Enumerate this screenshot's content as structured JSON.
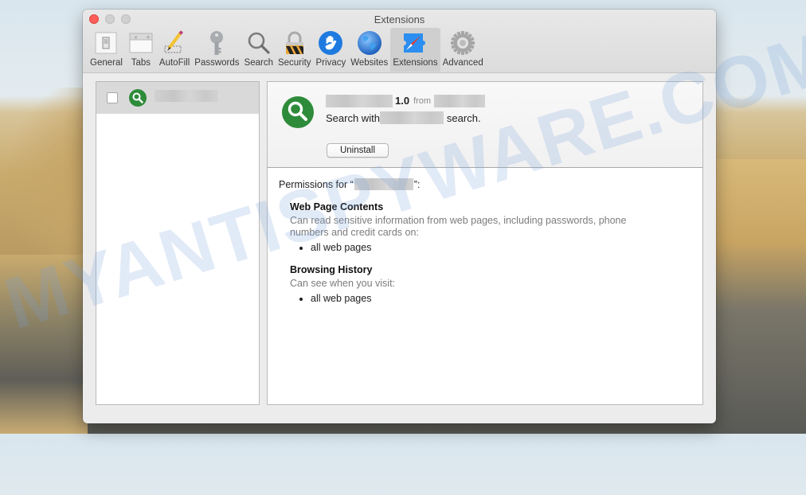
{
  "window": {
    "title": "Extensions"
  },
  "toolbar": {
    "items": [
      {
        "label": "General",
        "icon": "general-switch-icon",
        "active": false
      },
      {
        "label": "Tabs",
        "icon": "tabs-icon",
        "active": false
      },
      {
        "label": "AutoFill",
        "icon": "pencil-icon",
        "active": false
      },
      {
        "label": "Passwords",
        "icon": "key-icon",
        "active": false
      },
      {
        "label": "Search",
        "icon": "magnifier-icon",
        "active": false
      },
      {
        "label": "Security",
        "icon": "padlock-icon",
        "active": false
      },
      {
        "label": "Privacy",
        "icon": "hand-icon",
        "active": false
      },
      {
        "label": "Websites",
        "icon": "globe-icon",
        "active": false
      },
      {
        "label": "Extensions",
        "icon": "puzzle-compass-icon",
        "active": true
      },
      {
        "label": "Advanced",
        "icon": "gear-icon",
        "active": false
      }
    ]
  },
  "sidebar": {
    "extensions": [
      {
        "name": "",
        "enabled": false,
        "icon": "green-search-icon",
        "selected": true
      }
    ]
  },
  "detail": {
    "version": "1.0",
    "from_label": "from",
    "description_prefix": "Search with",
    "description_suffix": "search.",
    "uninstall_label": "Uninstall",
    "permissions_prefix": "Permissions for “",
    "permissions_suffix": "”:",
    "permissions": [
      {
        "title": "Web Page Contents",
        "description": "Can read sensitive information from web pages, including passwords, phone numbers and credit cards on:",
        "items": [
          "all web pages"
        ]
      },
      {
        "title": "Browsing History",
        "description": "Can see when you visit:",
        "items": [
          "all web pages"
        ]
      }
    ]
  },
  "watermark": "MYANTISPYWARE.COM",
  "colors": {
    "close_button": "#fc5f57",
    "extension_green": "#2e8b3a",
    "selected_row": "#d9d9d9",
    "active_tab": "#cfcfcf"
  }
}
